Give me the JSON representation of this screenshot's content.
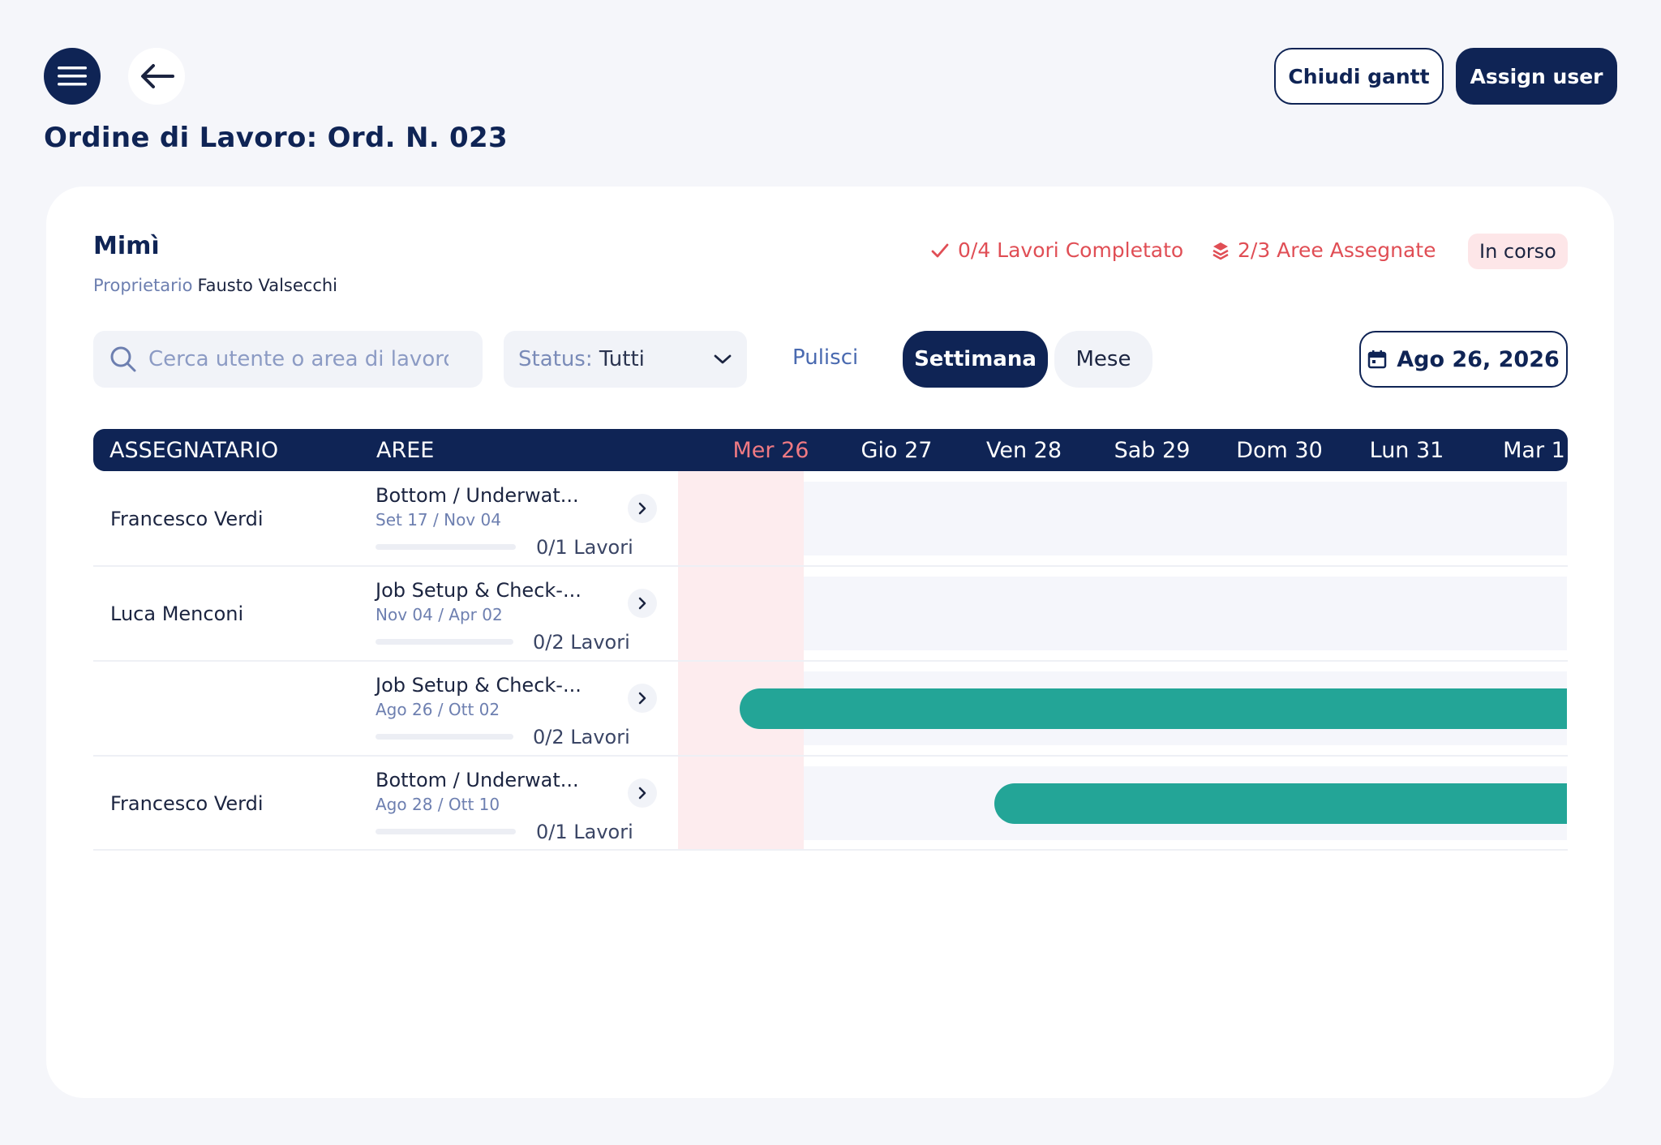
{
  "header": {
    "title": "Ordine di Lavoro: Ord. N. 023",
    "close_gantt_label": "Chiudi gantt",
    "assign_user_label": "Assign user"
  },
  "job": {
    "name": "Mimì",
    "owner_label": "Proprietario",
    "owner_name": "Fausto Valsecchi",
    "completed_stat": "0/4 Lavori Completato",
    "areas_stat": "2/3 Aree Assegnate",
    "status_badge": "In corso"
  },
  "filters": {
    "search_placeholder": "Cerca utente o area di lavoro",
    "status_prefix": "Status:",
    "status_value": "Tutti",
    "clear_label": "Pulisci",
    "week_label": "Settimana",
    "month_label": "Mese",
    "date_label": "Ago 26, 2026"
  },
  "table": {
    "col_assignee": "ASSEGNATARIO",
    "col_areas": "AREE",
    "days": [
      "Mer 26",
      "Gio 27",
      "Ven 28",
      "Sab 29",
      "Dom 30",
      "Lun 31",
      "Mar 1"
    ],
    "rows": [
      {
        "assignee": "Francesco Verdi",
        "area": "Bottom / Underwat...",
        "dates": "Set 17 / Nov 04",
        "works": "0/1 Lavori",
        "bar_start_day": null
      },
      {
        "assignee": "Luca Menconi",
        "area": "Job Setup & Check-...",
        "dates": "Nov 04 / Apr 02",
        "works": "0/2 Lavori",
        "bar_start_day": null
      },
      {
        "assignee": "",
        "area": "Job Setup & Check-...",
        "dates": "Ago 26 / Ott 02",
        "works": "0/2 Lavori",
        "bar_start_day": "Mer 26"
      },
      {
        "assignee": "Francesco Verdi",
        "area": "Bottom / Underwat...",
        "dates": "Ago 28 / Ott 10",
        "works": "0/1 Lavori",
        "bar_start_day": "Ven 28"
      }
    ]
  },
  "colors": {
    "primary": "#0f2455",
    "accent_red": "#e04e55",
    "today_highlight": "#fdecee",
    "bar": "#23a597"
  }
}
